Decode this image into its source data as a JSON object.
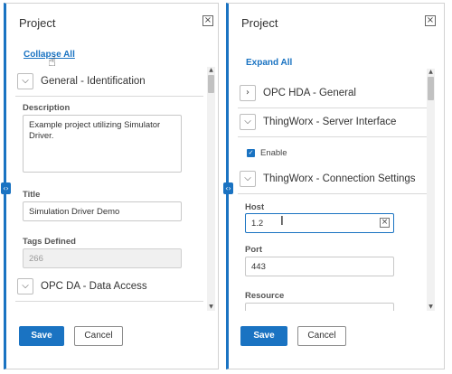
{
  "left_panel": {
    "title": "Project",
    "close_icon": "×",
    "toggle_link": "Collapse All",
    "collapse_handle_icon": "‹›",
    "sections": {
      "general": {
        "chevron": "⌵",
        "label": "General - Identification"
      },
      "opc_da": {
        "chevron": "⌵",
        "label": "OPC DA - Data Access"
      }
    },
    "fields": {
      "description": {
        "label": "Description",
        "value": "Example project utilizing Simulator Driver."
      },
      "title": {
        "label": "Title",
        "value": "Simulation Driver Demo"
      },
      "tags_defined": {
        "label": "Tags Defined",
        "value": "266"
      }
    },
    "buttons": {
      "save": "Save",
      "cancel": "Cancel"
    }
  },
  "right_panel": {
    "title": "Project",
    "close_icon": "×",
    "toggle_link": "Expand All",
    "collapse_handle_icon": "‹›",
    "sections": {
      "opc_hda": {
        "chevron": "›",
        "label": "OPC HDA - General"
      },
      "server_interface": {
        "chevron": "⌵",
        "label": "ThingWorx - Server Interface"
      },
      "connection_settings": {
        "chevron": "⌵",
        "label": "ThingWorx - Connection Settings"
      }
    },
    "enable_checkbox": {
      "label": "Enable",
      "checked": true,
      "check_mark": "✓"
    },
    "fields": {
      "host": {
        "label": "Host",
        "value": "1.2",
        "clear_icon": "×"
      },
      "port": {
        "label": "Port",
        "value": "443"
      },
      "resource": {
        "label": "Resource"
      }
    },
    "buttons": {
      "save": "Save",
      "cancel": "Cancel"
    }
  },
  "scroll_arrows": {
    "up": "▲",
    "down": "▼"
  },
  "cursors": {
    "hand": "☝",
    "text_beam": "I"
  },
  "colors": {
    "accent": "#1a73c2",
    "border": "#d2d2d2",
    "disabled_bg": "#f0f0f0"
  }
}
